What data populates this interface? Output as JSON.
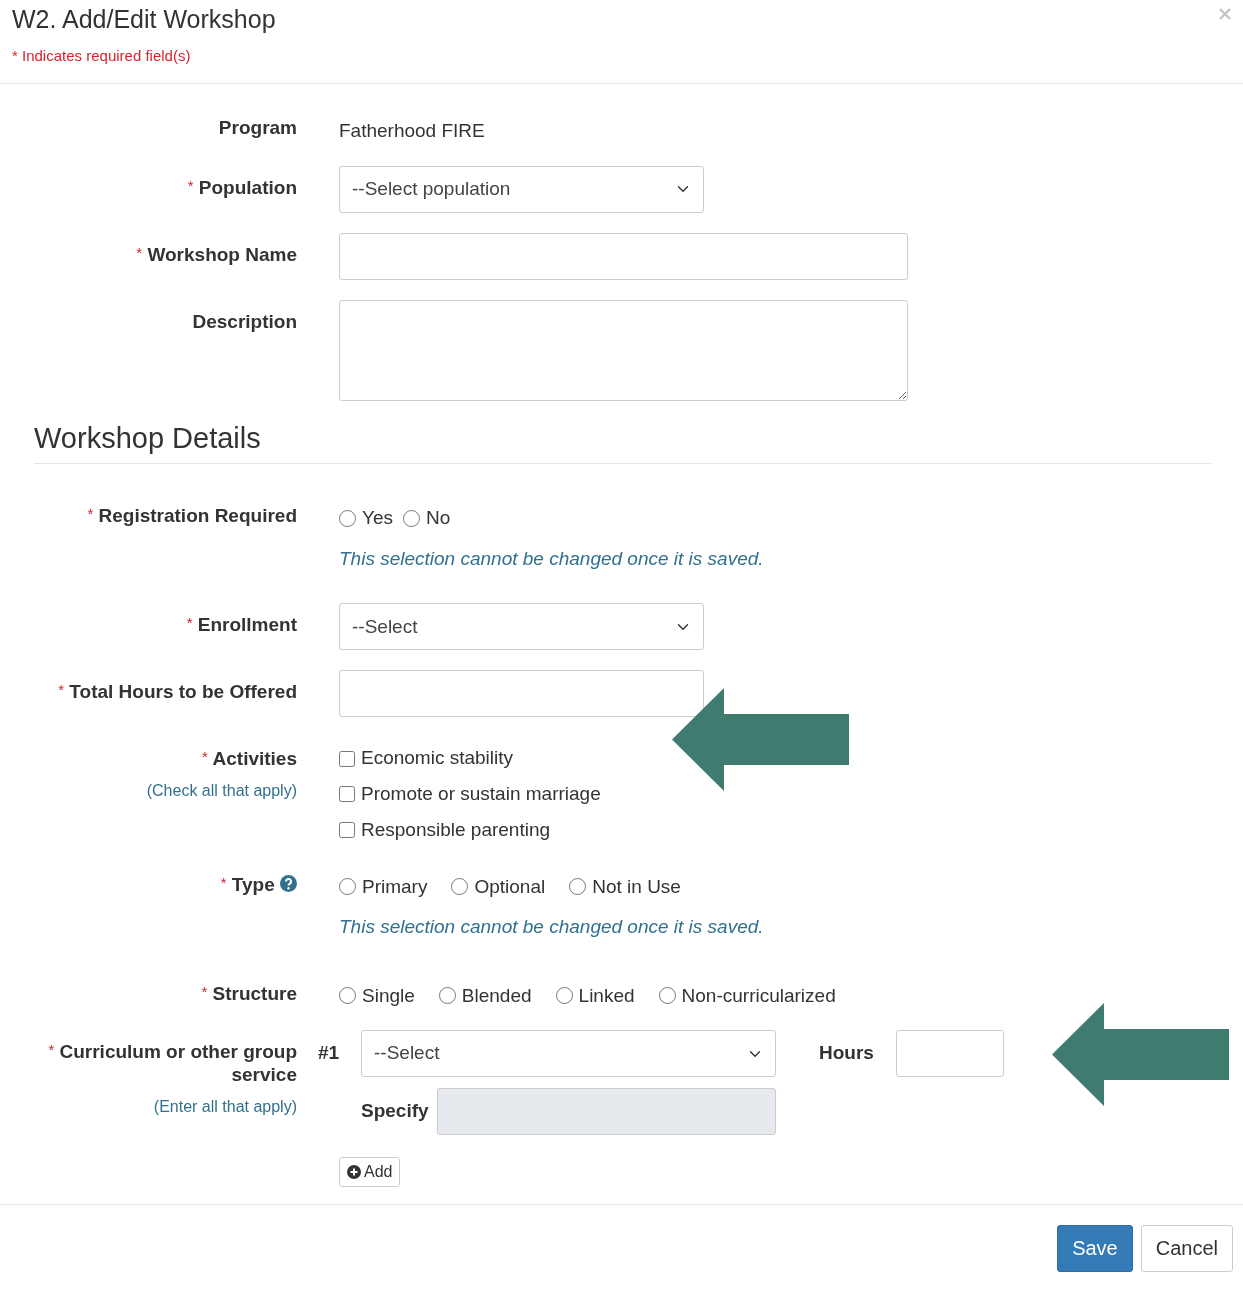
{
  "dialog": {
    "title": "W2. Add/Edit Workshop",
    "required_note": "* Indicates required field(s)"
  },
  "required_mark": "*",
  "fields": [
    {
      "kind": "static",
      "label": "Program",
      "required": false,
      "value": "Fatherhood FIRE"
    },
    {
      "kind": "select",
      "label": "Population",
      "required": true,
      "value": "--Select population"
    },
    {
      "kind": "text",
      "label": "Workshop Name",
      "required": true
    },
    {
      "kind": "textarea",
      "label": "Description",
      "required": false
    }
  ],
  "section_title": "Workshop Details",
  "details": [
    {
      "kind": "radios",
      "label": "Registration Required",
      "required": true,
      "options": [
        {
          "label": "Yes",
          "selected": false
        },
        {
          "label": "No",
          "selected": false
        }
      ],
      "note": "This selection cannot be changed once it is saved."
    },
    {
      "kind": "select",
      "label": "Enrollment",
      "required": true,
      "value": "--Select"
    },
    {
      "kind": "text",
      "label": "Total Hours to be Offered",
      "required": true
    },
    {
      "kind": "checkboxes",
      "label": "Activities",
      "required": true,
      "hint": "(Check all that apply)",
      "options": [
        {
          "label": "Economic stability",
          "checked": false
        },
        {
          "label": "Promote or sustain marriage",
          "checked": false
        },
        {
          "label": "Responsible parenting",
          "checked": false
        }
      ]
    },
    {
      "kind": "radios",
      "label": "Type",
      "required": true,
      "help": true,
      "options": [
        {
          "label": "Primary",
          "selected": false
        },
        {
          "label": "Optional",
          "selected": false
        },
        {
          "label": "Not in Use",
          "selected": false
        }
      ],
      "note": "This selection cannot be changed once it is saved."
    },
    {
      "kind": "radios",
      "label": "Structure",
      "required": true,
      "options": [
        {
          "label": "Single",
          "selected": false
        },
        {
          "label": "Blended",
          "selected": false
        },
        {
          "label": "Linked",
          "selected": false
        },
        {
          "label": "Non-curricularized",
          "selected": false
        }
      ]
    },
    {
      "kind": "curriculum",
      "label": "Curriculum or other group service",
      "required": true,
      "hint": "(Enter all that apply)",
      "number": "#1",
      "value": "--Select",
      "hours_label": "Hours",
      "specify_label": "Specify",
      "specify_disabled": true,
      "add_label": "Add"
    }
  ],
  "buttons": [
    {
      "label": "Save",
      "kind": "primary"
    },
    {
      "label": "Cancel",
      "kind": "secondary"
    }
  ]
}
